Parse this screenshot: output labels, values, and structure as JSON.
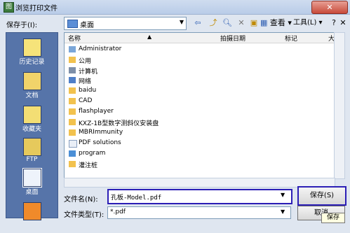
{
  "window": {
    "title": "浏览打印文件",
    "close_label": "✕"
  },
  "toolbar": {
    "save_in_label": "保存于(I):",
    "save_in_value": "桌面",
    "view_label": "查看",
    "tools_label": "工具(L)",
    "help_label": "?",
    "close_label": "✕"
  },
  "places": [
    {
      "label": "历史记录",
      "icon": "history-icon"
    },
    {
      "label": "文档",
      "icon": "documents-icon"
    },
    {
      "label": "收藏夹",
      "icon": "favorites-icon"
    },
    {
      "label": "FTP",
      "icon": "ftp-icon"
    },
    {
      "label": "桌面",
      "icon": "desktop-icon"
    }
  ],
  "columns": [
    "名称",
    "拍摄日期",
    "标记",
    "大"
  ],
  "files": [
    {
      "name": "Administrator",
      "icon": "user-folder-icon"
    },
    {
      "name": "公用",
      "icon": "folder-icon"
    },
    {
      "name": "计算机",
      "icon": "computer-icon"
    },
    {
      "name": "网络",
      "icon": "network-icon"
    },
    {
      "name": "baidu",
      "icon": "folder-icon"
    },
    {
      "name": "CAD",
      "icon": "folder-icon"
    },
    {
      "name": "flashplayer",
      "icon": "folder-icon"
    },
    {
      "name": "KXZ-1B型数字测斜仪安装盘",
      "icon": "folder-icon"
    },
    {
      "name": "MBRImmunity",
      "icon": "folder-icon"
    },
    {
      "name": "PDF solutions",
      "icon": "shortcut-icon"
    },
    {
      "name": "program",
      "icon": "program-icon"
    },
    {
      "name": "灌注桩",
      "icon": "folder-icon"
    }
  ],
  "filename": {
    "label": "文件名(N):",
    "value": "孔板-Model.pdf"
  },
  "filetype": {
    "label": "文件类型(T):",
    "value": "*.pdf"
  },
  "buttons": {
    "save": "保存(S)",
    "cancel": "取消"
  },
  "tooltip": "保存",
  "colors": {
    "accent": "#2c1fb6",
    "sidebar": "#5674a9",
    "folder": "#f2c24e"
  }
}
